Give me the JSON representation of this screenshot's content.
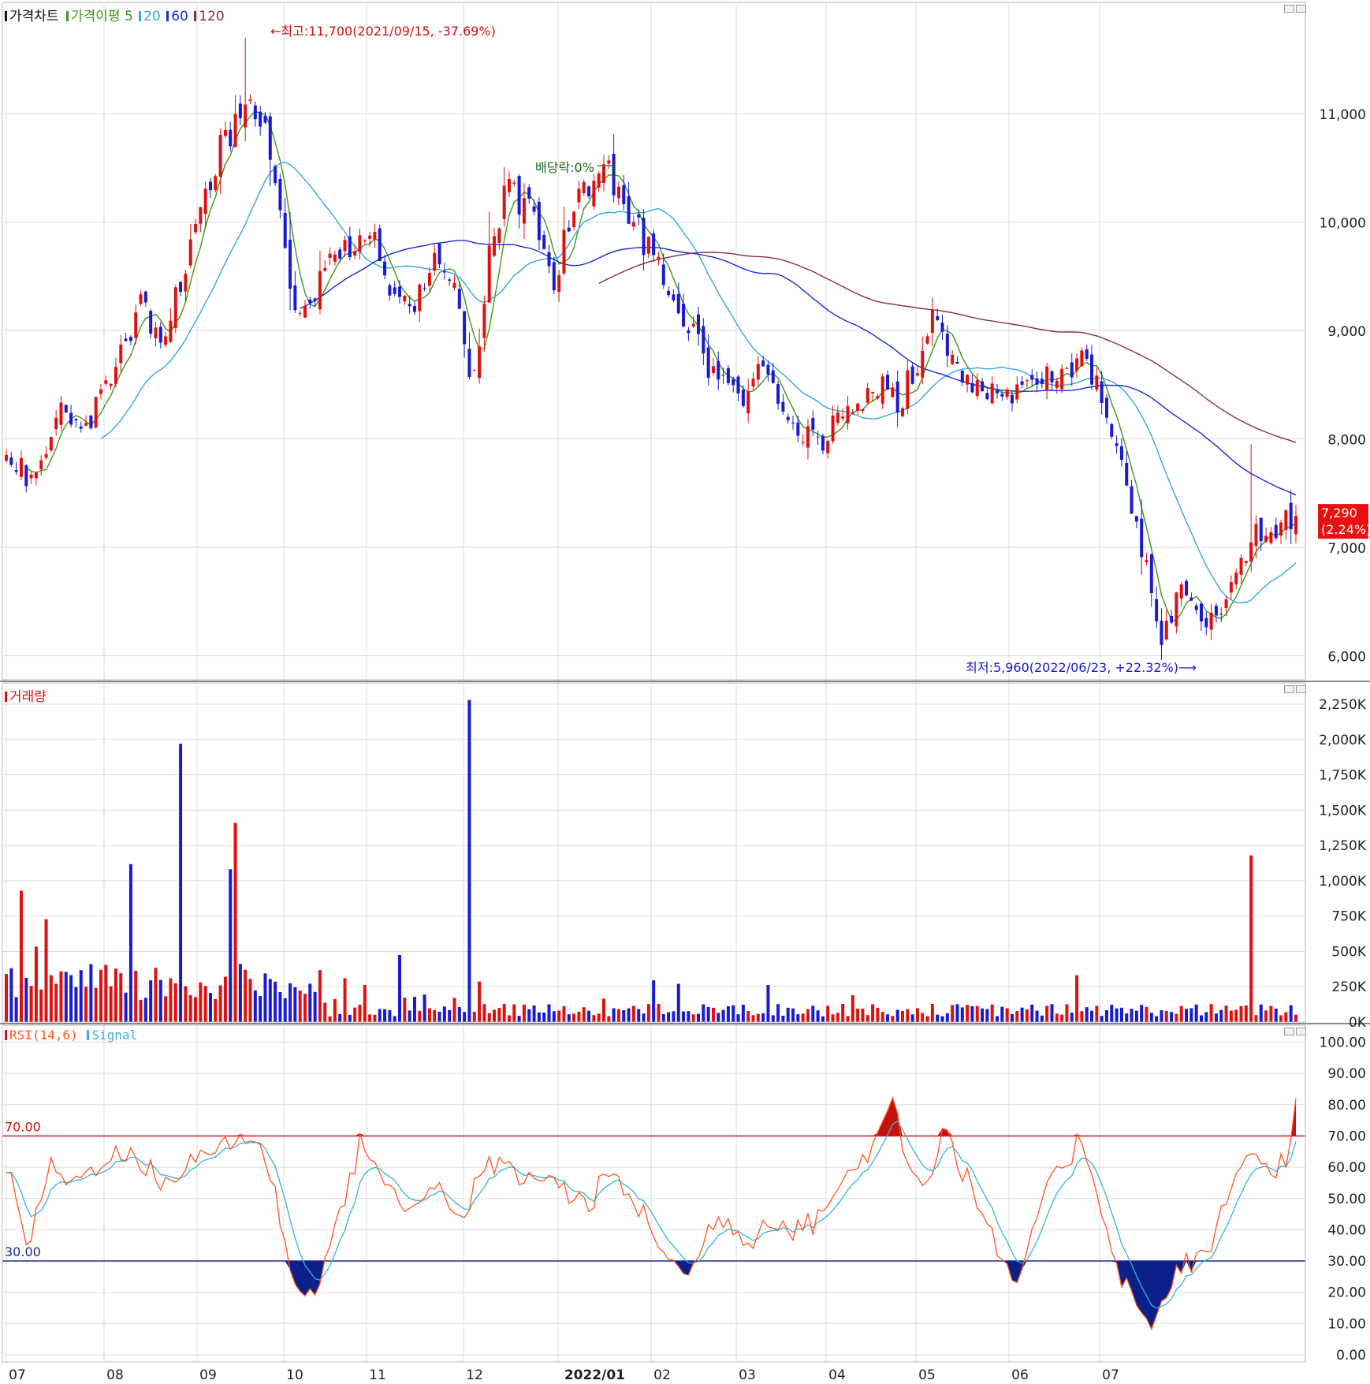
{
  "price_panel": {
    "title": "가격차트",
    "ma_label": "가격이평",
    "ma_periods": [
      "5",
      "20",
      "60",
      "120"
    ],
    "ma_colors": [
      "#3a9a1a",
      "#36a7dd",
      "#1a2bd0",
      "#8a2a55"
    ],
    "high_note": "←최고:11,700(2021/09/15, -37.69%)",
    "low_note": "최저:5,960(2022/06/23, +22.32%)⟶",
    "dividend_note": "배당락:0%",
    "last_price": "7,290",
    "last_change": "(2.24%)",
    "y_ticks": [
      "11,000",
      "10,000",
      "9,000",
      "8,000",
      "7,000",
      "6,000"
    ]
  },
  "volume_panel": {
    "title": "거래량",
    "y_ticks": [
      "2,250K",
      "2,000K",
      "1,750K",
      "1,500K",
      "1,250K",
      "1,000K",
      "750K",
      "500K",
      "250K",
      "0K"
    ]
  },
  "rsi_panel": {
    "title": "RSI(14,6)",
    "signal_label": "Signal",
    "upper_label": "70.00",
    "lower_label": "30.00",
    "y_ticks": [
      "100.00",
      "90.00",
      "80.00",
      "70.00",
      "60.00",
      "50.00",
      "40.00",
      "30.00",
      "20.00",
      "10.00",
      "0.00"
    ]
  },
  "x_axis": {
    "labels": [
      "07",
      "08",
      "09",
      "10",
      "11",
      "12",
      "2022/01",
      "02",
      "03",
      "04",
      "05",
      "06",
      "07"
    ]
  },
  "colors": {
    "up": "#e01010",
    "down": "#1a1ad0",
    "rsi": "#ff5522",
    "signal": "#36b4d8",
    "upper_line": "#d81818",
    "lower_line": "#1a2b8a"
  },
  "chart_data": [
    {
      "type": "candlestick",
      "title": "가격차트",
      "x_labels": [
        "07",
        "08",
        "09",
        "10",
        "11",
        "12",
        "2022/01",
        "02",
        "03",
        "04",
        "05",
        "06",
        "07"
      ],
      "ylim": [
        5900,
        11800
      ],
      "anchor_closes": [
        {
          "x": "2021/07",
          "close": 7850
        },
        {
          "x": "2021/08 mid",
          "close": 8200
        },
        {
          "x": "2021/09 start",
          "close": 9600
        },
        {
          "x": "2021/09/15",
          "close": 11000,
          "high": 11700
        },
        {
          "x": "2021/10 start",
          "close": 9700
        },
        {
          "x": "2021/10 mid",
          "close": 9200
        },
        {
          "x": "2021/11 start",
          "close": 9800
        },
        {
          "x": "2021/11 end",
          "close": 9300
        },
        {
          "x": "2021/12 start",
          "close": 8400
        },
        {
          "x": "2021/12 mid",
          "close": 10300
        },
        {
          "x": "2021/12 end",
          "close": 10500
        },
        {
          "x": "2022/01 mid",
          "close": 9700
        },
        {
          "x": "2022/02 start",
          "close": 8700
        },
        {
          "x": "2022/02 mid",
          "close": 8300
        },
        {
          "x": "2022/03 mid",
          "close": 7900
        },
        {
          "x": "2022/04 start",
          "close": 8500
        },
        {
          "x": "2022/04 mid",
          "close": 9000
        },
        {
          "x": "2022/05 start",
          "close": 8500
        },
        {
          "x": "2022/05 end",
          "close": 8600
        },
        {
          "x": "2022/06 mid",
          "close": 7000
        },
        {
          "x": "2022/06/23",
          "close": 6100,
          "low": 5960
        },
        {
          "x": "2022/07 start",
          "close": 6500
        },
        {
          "x": "2022/07 end",
          "close": 7290
        }
      ],
      "moving_averages": [
        "5",
        "20",
        "60",
        "120"
      ]
    },
    {
      "type": "bar",
      "title": "거래량",
      "ylim": [
        0,
        2300000
      ],
      "peaks": [
        {
          "x": "2021/08 late",
          "value": 1970000
        },
        {
          "x": "2021/09 mid",
          "value": 1410000
        },
        {
          "x": "2021/12 start",
          "value": 2280000
        },
        {
          "x": "2022/07 mid",
          "value": 1180000
        }
      ]
    },
    {
      "type": "line",
      "title": "RSI(14,6)",
      "series": [
        {
          "name": "RSI(14,6)"
        },
        {
          "name": "Signal"
        }
      ],
      "ylim": [
        0,
        100
      ],
      "reference_lines": [
        70,
        30
      ],
      "anchor_values": [
        {
          "x": "2021/07",
          "rsi": 55
        },
        {
          "x": "2021/09 mid",
          "rsi": 70
        },
        {
          "x": "2021/10 start",
          "rsi": 16
        },
        {
          "x": "2021/11 start",
          "rsi": 70
        },
        {
          "x": "2022/01 end",
          "rsi": 25
        },
        {
          "x": "2022/04 start",
          "rsi": 82
        },
        {
          "x": "2022/05 start",
          "rsi": 18
        },
        {
          "x": "2022/06 end",
          "rsi": 10
        },
        {
          "x": "2022/07 end",
          "rsi": 82
        }
      ]
    }
  ]
}
